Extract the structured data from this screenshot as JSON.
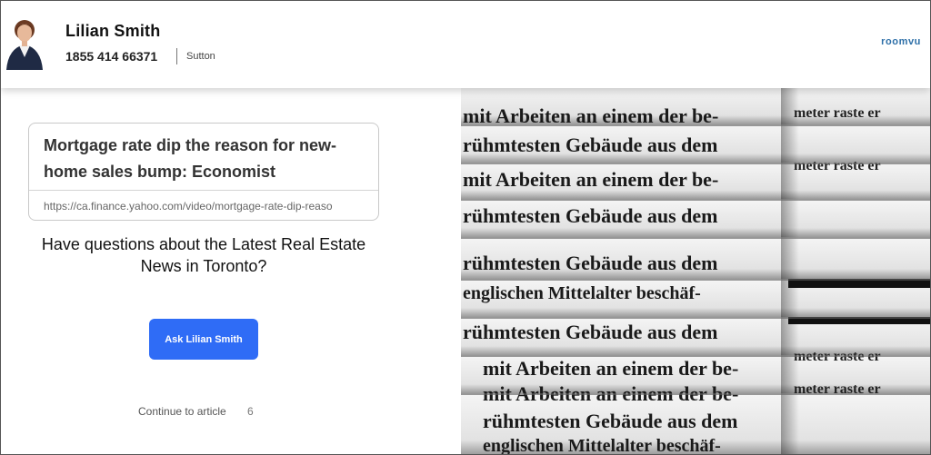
{
  "header": {
    "agent_name": "Lilian Smith",
    "phone": "1855 414 66371",
    "brokerage": "Sutton",
    "brand": "roomvu"
  },
  "article_card": {
    "title": "Mortgage rate dip the reason for new-home sales bump: Economist",
    "url": "https://ca.finance.yahoo.com/video/mortgage-rate-dip-reaso"
  },
  "cta": {
    "question": "Have questions about the Latest Real Estate News in Toronto?",
    "button_label": "Ask Lilian Smith",
    "continue_label": "Continue to article",
    "countdown": "6"
  },
  "newspaper": {
    "lines": [
      "mit Arbeiten an einem der be-",
      "rühmtesten Gebäude aus dem",
      "englischen Mittelalter beschäf-",
      "meter raste er"
    ]
  }
}
